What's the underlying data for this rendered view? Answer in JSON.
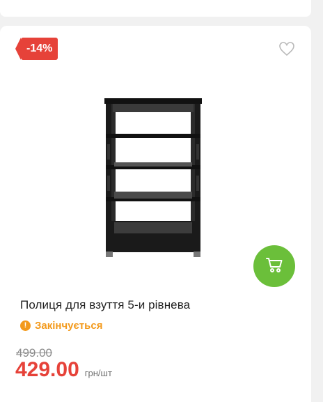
{
  "product": {
    "discount_badge": "-14%",
    "title": "Полиця для взуття 5-и рівнева",
    "status": "Закінчується",
    "status_icon": "exclamation-icon",
    "old_price": "499.00",
    "price": "429.00",
    "unit": "грн/шт"
  },
  "icons": {
    "favorite": "heart-outline-icon",
    "cart": "cart-icon"
  },
  "colors": {
    "accent_red": "#e64239",
    "cart_green": "#6bbf3a",
    "status_orange": "#f39a1c"
  }
}
